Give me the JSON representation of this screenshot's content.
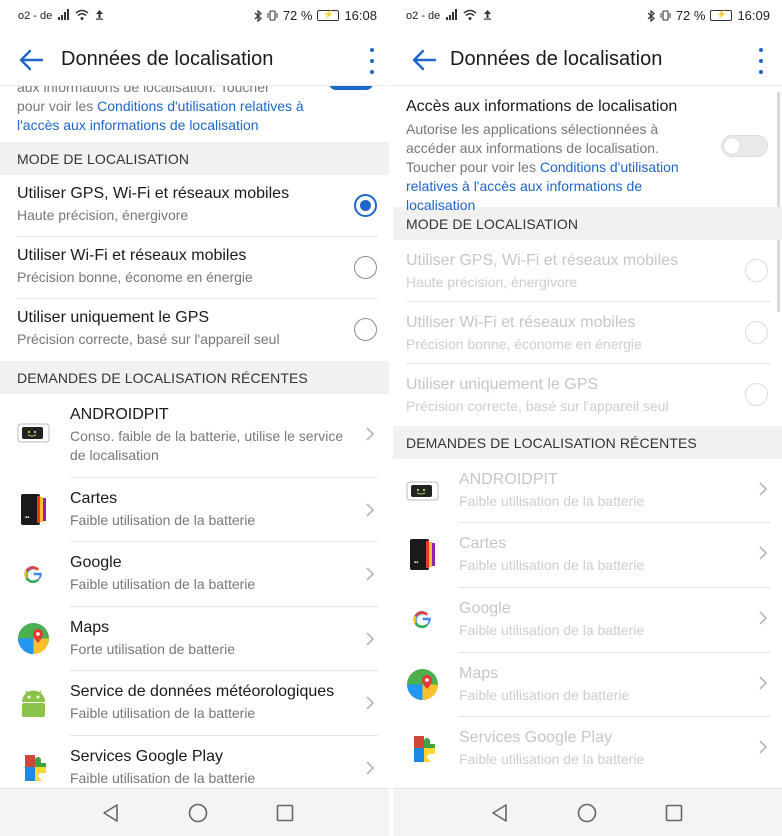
{
  "status_left": {
    "carrier": "o2 - de",
    "battery_pct": "72 %",
    "time": "16:08"
  },
  "status_right": {
    "carrier": "o2 - de",
    "battery_pct": "72 %",
    "time": "16:09"
  },
  "appbar": {
    "title": "Données de localisation"
  },
  "left": {
    "intro_fragment": {
      "line1": "aux informations de localisation. Toucher",
      "pre": "pour voir les ",
      "link": "Conditions d'utilisation relatives à l'accès aux informations de localisation"
    },
    "mode_header": "MODE DE LOCALISATION",
    "modes": [
      {
        "title": "Utiliser GPS, Wi-Fi et réseaux mobiles",
        "subtitle": "Haute précision, énergivore"
      },
      {
        "title": "Utiliser Wi-Fi et réseaux mobiles",
        "subtitle": "Précision bonne, économe en énergie"
      },
      {
        "title": "Utiliser uniquement le GPS",
        "subtitle": "Précision correcte, basé sur l'appareil seul"
      }
    ],
    "recent_header": "DEMANDES DE LOCALISATION RÉCENTES",
    "apps": [
      {
        "name": "ANDROIDPIT",
        "usage": "Conso. faible de la batterie, utilise le service de localisation"
      },
      {
        "name": "Cartes",
        "usage": "Faible utilisation de la batterie"
      },
      {
        "name": "Google",
        "usage": "Faible utilisation de la batterie"
      },
      {
        "name": "Maps",
        "usage": "Forte utilisation de batterie"
      },
      {
        "name": "Service de données météorologiques",
        "usage": "Faible utilisation de la batterie"
      },
      {
        "name": "Services Google Play",
        "usage": "Faible utilisation de la batterie"
      }
    ]
  },
  "right": {
    "access": {
      "title": "Accès aux informations de localisation",
      "desc_pre": "Autorise les applications sélectionnées à accéder aux informations de localisation. Toucher pour voir les ",
      "link": "Conditions d'utilisation relatives à l'accès aux informations de localisation",
      "toggle_on": false
    },
    "mode_header": "MODE DE LOCALISATION",
    "modes": [
      {
        "title": "Utiliser GPS, Wi-Fi et réseaux mobiles",
        "subtitle": "Haute précision, énergivore"
      },
      {
        "title": "Utiliser Wi-Fi et réseaux mobiles",
        "subtitle": "Précision bonne, économe en énergie"
      },
      {
        "title": "Utiliser uniquement le GPS",
        "subtitle": "Précision correcte, basé sur l'appareil seul"
      }
    ],
    "recent_header": "DEMANDES DE LOCALISATION RÉCENTES",
    "apps": [
      {
        "name": "ANDROIDPIT",
        "usage": "Faible utilisation de la batterie"
      },
      {
        "name": "Cartes",
        "usage": "Faible utilisation de la batterie"
      },
      {
        "name": "Google",
        "usage": "Faible utilisation de la batterie"
      },
      {
        "name": "Maps",
        "usage": "Faible utilisation de batterie"
      },
      {
        "name": "Services Google Play",
        "usage": "Faible utilisation de la batterie"
      }
    ]
  },
  "colors": {
    "accent": "#1e66c9",
    "section_bg": "#f1f1f1",
    "disabled_text": "#c6c6c6"
  },
  "icons": [
    "back-arrow-icon",
    "more-vert-icon",
    "radio-button",
    "chevron-right-icon",
    "androidpit-icon",
    "cartes-icon",
    "google-icon",
    "maps-icon",
    "android-weather-icon",
    "google-play-services-icon",
    "nav-back-icon",
    "nav-home-icon",
    "nav-recents-icon"
  ]
}
